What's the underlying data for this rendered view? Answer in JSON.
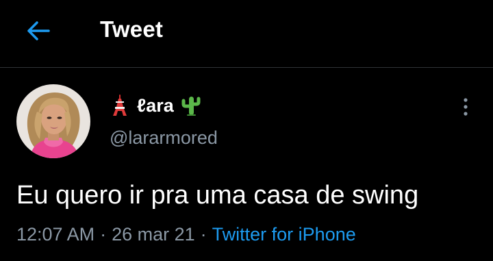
{
  "header": {
    "title": "Tweet",
    "back_icon": "arrow-left-icon"
  },
  "author": {
    "display_name": "ℓara",
    "prefix_emoji": "tokyo-tower-icon",
    "suffix_emoji": "cactus-icon",
    "handle": "@lararmored"
  },
  "tweet": {
    "text": "Eu quero ir pra uma casa de swing",
    "time": "12:07 AM",
    "date": "26 mar 21",
    "separator": "·",
    "source": "Twitter for iPhone"
  },
  "colors": {
    "background": "#000000",
    "accent": "#1d9bf0",
    "secondary_text": "#8b98a5",
    "divider": "#2f3336"
  }
}
